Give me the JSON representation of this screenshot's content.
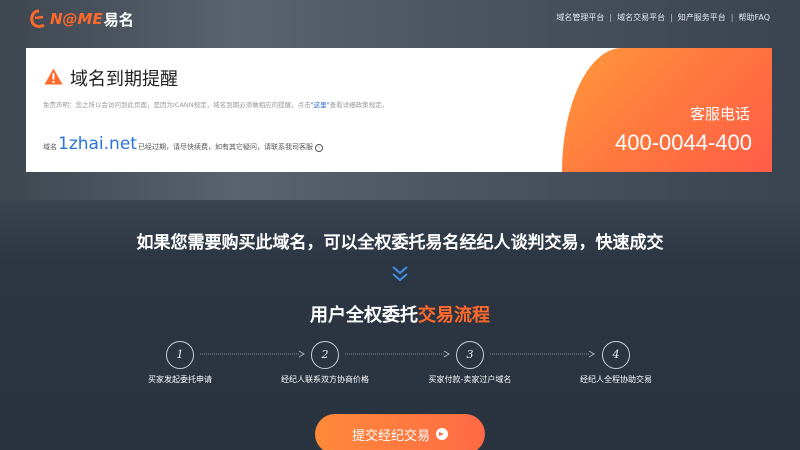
{
  "header": {
    "logo_text": "N@ME",
    "logo_cn": "易名",
    "nav": [
      {
        "label": "域名管理平台"
      },
      {
        "label": "域名交易平台"
      },
      {
        "label": "知产服务平台"
      },
      {
        "label": "帮助FAQ"
      }
    ]
  },
  "notice": {
    "title": "域名到期提醒",
    "disclaimer_prefix": "免责声明：您之所以会访问到此页面，是因为ICANN规定，域名到期必须做相应的提醒，点击",
    "disclaimer_link": "\"这里\"",
    "disclaimer_suffix": "查看详细政策规定。",
    "expired_prefix": "域名",
    "domain": "1zhai.net",
    "expired_suffix": "已经过期，请尽快续费，如有其它疑问，请联系我司客服",
    "hotline_label": "客服电话",
    "hotline_number": "400-0044-400"
  },
  "main": {
    "headline": "如果您需要购买此域名，可以全权委托易名经纪人谈判交易，快速成交",
    "flow_title_prefix": "用户全权委托",
    "flow_title_accent": "交易流程",
    "steps": [
      {
        "num": "1",
        "label": "买家发起委托申请"
      },
      {
        "num": "2",
        "label": "经纪人联系双方协商价格"
      },
      {
        "num": "3",
        "label": "买家付款-卖家过户域名"
      },
      {
        "num": "4",
        "label": "经纪人全程协助交易"
      }
    ],
    "cta_label": "提交经纪交易"
  },
  "colors": {
    "accent": "#ff6a2a",
    "link": "#2a73d9",
    "background": "#2c3542"
  }
}
